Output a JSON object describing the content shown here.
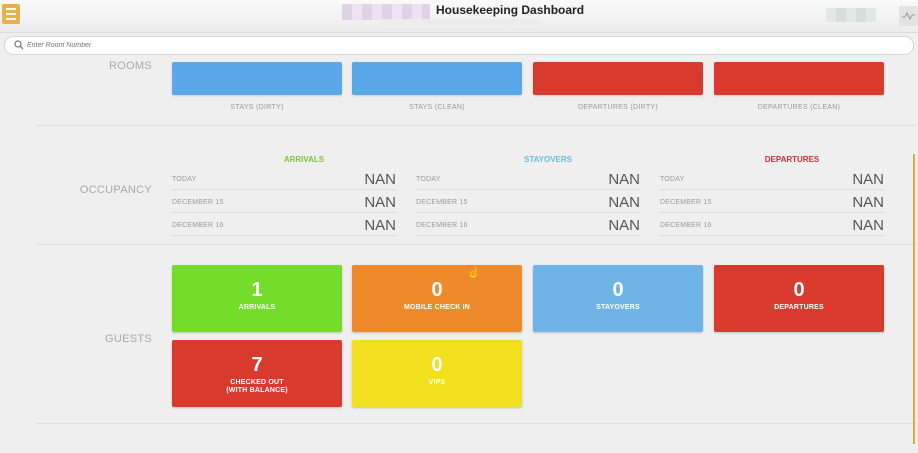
{
  "header": {
    "title": "Housekeeping Dashboard"
  },
  "search": {
    "placeholder": "Enter Room Number"
  },
  "sections": {
    "rooms": "ROOMS",
    "occupancy": "OCCUPANCY",
    "guests": "GUESTS"
  },
  "rooms": [
    {
      "label": "STAYS (DIRTY)",
      "color": "#5aa8ea"
    },
    {
      "label": "STAYS (CLEAN)",
      "color": "#5aa8ea"
    },
    {
      "label": "DEPARTURES (DIRTY)",
      "color": "#d93a2e"
    },
    {
      "label": "DEPARTURES (CLEAN)",
      "color": "#d93a2e"
    }
  ],
  "occupancy": [
    {
      "title": "ARRIVALS",
      "color": "#7cc242",
      "rows": [
        {
          "label": "TODAY",
          "value": "NAN"
        },
        {
          "label": "DECEMBER 15",
          "value": "NAN"
        },
        {
          "label": "DECEMBER 16",
          "value": "NAN"
        }
      ]
    },
    {
      "title": "STAYOVERS",
      "color": "#6bb8e3",
      "rows": [
        {
          "label": "TODAY",
          "value": "NAN"
        },
        {
          "label": "DECEMBER 15",
          "value": "NAN"
        },
        {
          "label": "DECEMBER 16",
          "value": "NAN"
        }
      ]
    },
    {
      "title": "DEPARTURES",
      "color": "#cf2f3a",
      "rows": [
        {
          "label": "TODAY",
          "value": "NAN"
        },
        {
          "label": "DECEMBER 15",
          "value": "NAN"
        },
        {
          "label": "DECEMBER 16",
          "value": "NAN"
        }
      ]
    }
  ],
  "guests": [
    {
      "count": "1",
      "label": "ARRIVALS",
      "color": "#74dc2a"
    },
    {
      "count": "0",
      "label": "MOBILE CHECK IN",
      "color": "#ee8a2c"
    },
    {
      "count": "0",
      "label": "STAYOVERS",
      "color": "#6fb4e6"
    },
    {
      "count": "0",
      "label": "DEPARTURES",
      "color": "#d93a2e"
    },
    {
      "count": "7",
      "label": "CHECKED OUT\n(WITH BALANCE)",
      "color": "#d93a2e"
    },
    {
      "count": "0",
      "label": "VIPS",
      "color": "#f2e01e"
    }
  ],
  "icons": {
    "menu": "hamburger-menu-icon",
    "search": "search-icon",
    "corner": "activity-icon"
  }
}
